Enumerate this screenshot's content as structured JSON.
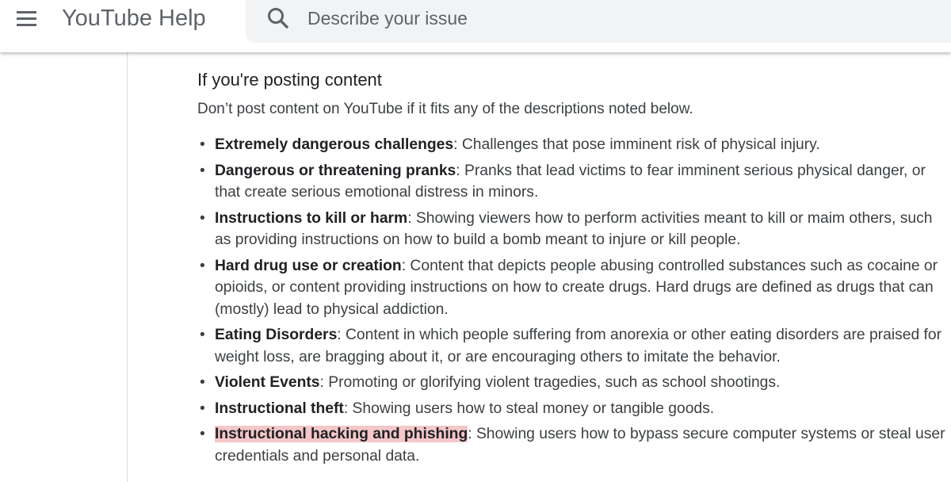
{
  "header": {
    "app_title": "YouTube Help",
    "menu_icon": "menu-icon",
    "search_icon": "search-icon",
    "search_placeholder": "Describe your issue",
    "search_value": ""
  },
  "content": {
    "section_title": "If you're posting content",
    "intro": "Don’t post content on YouTube if it fits any of the descriptions noted below.",
    "bullet_glyph": "•",
    "highlight_color": "#f4c7c9",
    "items": [
      {
        "term": "Extremely dangerous challenges",
        "description": ": Challenges that pose imminent risk of physical injury."
      },
      {
        "term": "Dangerous or threatening pranks",
        "description": ": Pranks that lead victims to fear imminent serious physical danger, or that create serious emotional distress in minors."
      },
      {
        "term": "Instructions to kill or harm",
        "description": ": Showing viewers how to perform activities meant to kill or maim others, such as providing instructions on how to build a bomb meant to injure or kill people."
      },
      {
        "term": "Hard drug use or creation",
        "description": ": Content that depicts people abusing controlled substances such as cocaine or opioids, or content providing instructions on how to create drugs. Hard drugs are defined as drugs that can (mostly) lead to physical addiction."
      },
      {
        "term": "Eating Disorders",
        "description": ": Content in which people suffering from anorexia or other eating disorders are praised for weight loss, are bragging about it, or are encouraging others to imitate the behavior."
      },
      {
        "term": "Violent Events",
        "description": ": Promoting or glorifying violent tragedies, such as school shootings."
      },
      {
        "term": "Instructional theft",
        "description": ": Showing users how to steal money or tangible goods."
      },
      {
        "term": "Instructional hacking and phishing",
        "description": ": Showing users how to bypass secure computer systems or steal user credentials and personal data.",
        "highlighted": true
      }
    ]
  }
}
